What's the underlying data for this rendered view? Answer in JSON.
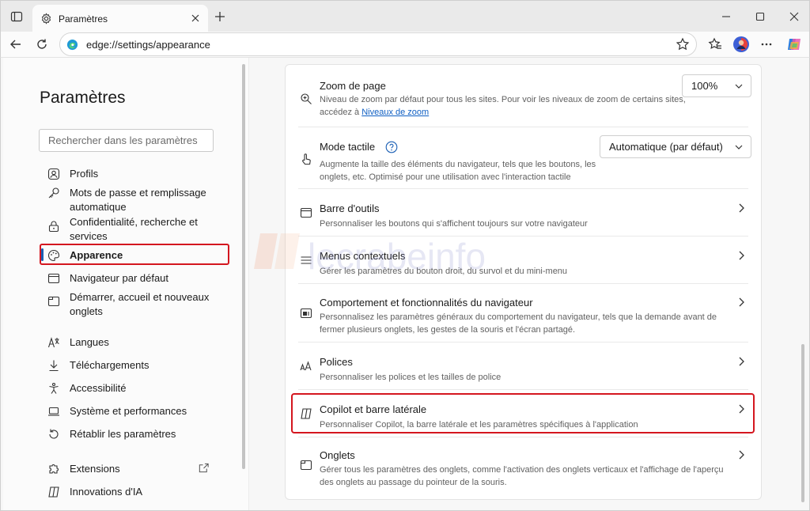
{
  "browser": {
    "tab_title": "Paramètres",
    "url": "edge://settings/appearance"
  },
  "sidebar": {
    "title": "Paramètres",
    "search_placeholder": "Rechercher dans les paramètres",
    "items": [
      {
        "label": "Profils",
        "icon": "profile-icon"
      },
      {
        "label": "Mots de passe et remplissage automatique",
        "icon": "key-icon"
      },
      {
        "label": "Confidentialité, recherche et services",
        "icon": "lock-icon"
      },
      {
        "label": "Apparence",
        "icon": "palette-icon",
        "active": true
      },
      {
        "label": "Navigateur par défaut",
        "icon": "browser-icon"
      },
      {
        "label": "Démarrer, accueil et nouveaux onglets",
        "icon": "home-icon"
      },
      {
        "label": "Langues",
        "icon": "language-icon"
      },
      {
        "label": "Téléchargements",
        "icon": "download-icon"
      },
      {
        "label": "Accessibilité",
        "icon": "accessibility-icon"
      },
      {
        "label": "Système et performances",
        "icon": "laptop-icon"
      },
      {
        "label": "Rétablir les paramètres",
        "icon": "reset-icon"
      },
      {
        "label": "Extensions",
        "icon": "puzzle-icon"
      },
      {
        "label": "Innovations d'IA",
        "icon": "ai-icon"
      }
    ]
  },
  "settings": {
    "zoom": {
      "title": "Zoom de page",
      "desc_line1": "Niveau de zoom par défaut pour tous les sites. Pour voir les niveaux de zoom de certains sites,",
      "desc_line2_prefix": "accédez à ",
      "desc_link": "Niveaux de zoom",
      "value": "100%"
    },
    "touch": {
      "title": "Mode tactile",
      "desc_line1": "Augmente la taille des éléments du navigateur, tels que les boutons, les",
      "desc_line2": "onglets, etc. Optimisé pour une utilisation avec l'interaction tactile",
      "value": "Automatique (par défaut)"
    },
    "toolbar": {
      "title": "Barre d'outils",
      "desc": "Personnaliser les boutons qui s'affichent toujours sur votre navigateur"
    },
    "context_menus": {
      "title": "Menus contextuels",
      "desc": "Gérer les paramètres du bouton droit, du survol et du mini-menu"
    },
    "behavior": {
      "title": "Comportement et fonctionnalités du navigateur",
      "desc_line1": "Personnalisez les paramètres généraux du comportement du navigateur, tels que la demande avant de",
      "desc_line2": "fermer plusieurs onglets, les gestes de la souris et l'écran partagé."
    },
    "fonts": {
      "title": "Polices",
      "desc": "Personnaliser les polices et les tailles de police"
    },
    "copilot": {
      "title": "Copilot et barre latérale",
      "desc": "Personnaliser Copilot, la barre latérale et les paramètres spécifiques à l'application"
    },
    "tabs": {
      "title": "Onglets",
      "desc_line1": "Gérer tous les paramètres des onglets, comme l'activation des onglets verticaux et l'affichage de l'aperçu",
      "desc_line2": "des onglets au passage du pointeur de la souris."
    }
  },
  "watermark": "lecrabeinfo",
  "colors": {
    "highlight": "#d4161f",
    "accent": "#1a5fb4",
    "link": "#0f5fc3"
  }
}
